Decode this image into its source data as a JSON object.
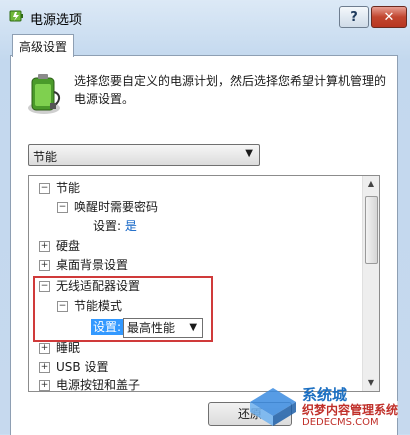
{
  "window": {
    "title": "电源选项"
  },
  "titlebar": {
    "help_label": "?",
    "close_label": "✕"
  },
  "tab": {
    "label": "高级设置"
  },
  "intro": {
    "text": "选择您要自定义的电源计划，然后选择您希望计算机管理的电源设置。"
  },
  "plan_select": {
    "value": "节能"
  },
  "tree": {
    "rows": [
      {
        "label": "节能",
        "expander": "−"
      },
      {
        "label": "唤醒时需要密码",
        "expander": "−"
      },
      {
        "label": "设置:",
        "value": "是"
      },
      {
        "label": "硬盘",
        "expander": "+"
      },
      {
        "label": "桌面背景设置",
        "expander": "+"
      },
      {
        "label": "无线适配器设置",
        "expander": "−"
      },
      {
        "label": "节能模式",
        "expander": "−"
      },
      {
        "label": "设置:",
        "value": "最高性能"
      },
      {
        "label": "睡眠",
        "expander": "+"
      },
      {
        "label": "USB 设置",
        "expander": "+"
      },
      {
        "label": "电源按钮和盖子",
        "expander": "+"
      }
    ]
  },
  "buttons": {
    "restore_label": "还原"
  },
  "watermark": {
    "line1": "系统城",
    "line2": "织梦内容管理系统",
    "line3": "DEDECMS.COM"
  },
  "colors": {
    "highlight": "#d03a3a",
    "link": "#0a5fc4",
    "selection": "#3399ff"
  }
}
